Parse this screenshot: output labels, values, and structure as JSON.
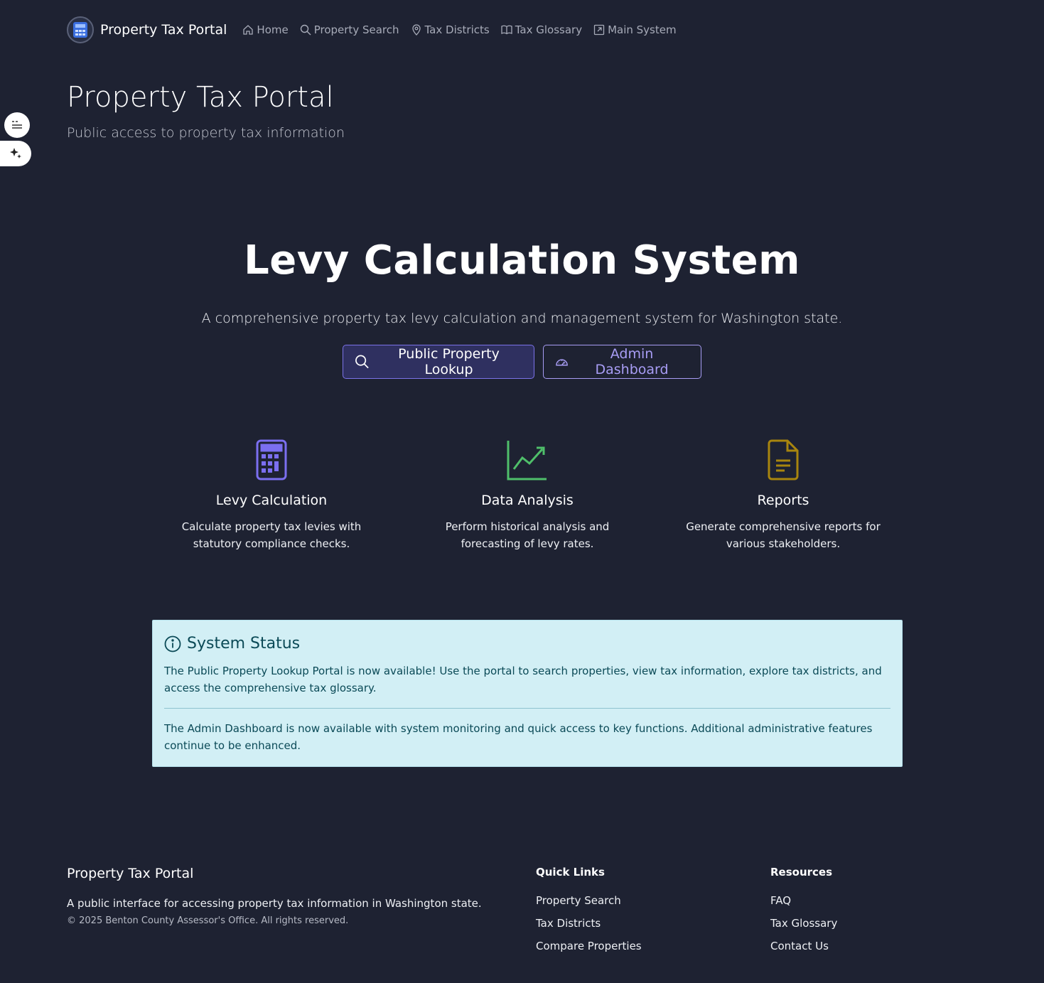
{
  "nav": {
    "brand": "Property Tax Portal",
    "items": [
      {
        "label": "Home",
        "icon": "home-icon"
      },
      {
        "label": "Property Search",
        "icon": "search-icon"
      },
      {
        "label": "Tax Districts",
        "icon": "map-pin-icon"
      },
      {
        "label": "Tax Glossary",
        "icon": "book-icon"
      },
      {
        "label": "Main System",
        "icon": "external-link-icon"
      }
    ]
  },
  "header": {
    "title": "Property Tax Portal",
    "subtitle": "Public access to property tax information"
  },
  "hero": {
    "title": "Levy Calculation System",
    "lead": "A comprehensive property tax levy calculation and management system for Washington state.",
    "primary_button": "Public Property Lookup",
    "secondary_button": "Admin Dashboard"
  },
  "features": [
    {
      "title": "Levy Calculation",
      "text": "Calculate property tax levies with statutory compliance checks.",
      "icon": "calculator-icon",
      "color": "#7b6ff0"
    },
    {
      "title": "Data Analysis",
      "text": "Perform historical analysis and forecasting of levy rates.",
      "icon": "chart-line-icon",
      "color": "#4fbf6a"
    },
    {
      "title": "Reports",
      "text": "Generate comprehensive reports for various stakeholders.",
      "icon": "document-icon",
      "color": "#a8850e"
    }
  ],
  "status": {
    "title": "System Status",
    "message1": "The Public Property Lookup Portal is now available! Use the portal to search properties, view tax information, explore tax districts, and access the comprehensive tax glossary.",
    "message2": "The Admin Dashboard is now available with system monitoring and quick access to key functions. Additional administrative features continue to be enhanced."
  },
  "footer": {
    "title": "Property Tax Portal",
    "description": "A public interface for accessing property tax information in Washington state.",
    "copyright": "© 2025 Benton County Assessor's Office. All rights reserved.",
    "quick_links": {
      "heading": "Quick Links",
      "links": [
        "Property Search",
        "Tax Districts",
        "Compare Properties"
      ]
    },
    "resources": {
      "heading": "Resources",
      "links": [
        "FAQ",
        "Tax Glossary",
        "Contact Us"
      ]
    }
  },
  "colors": {
    "background": "#1e2232",
    "accent": "#7b72e8",
    "status_bg": "#d2eff5"
  }
}
